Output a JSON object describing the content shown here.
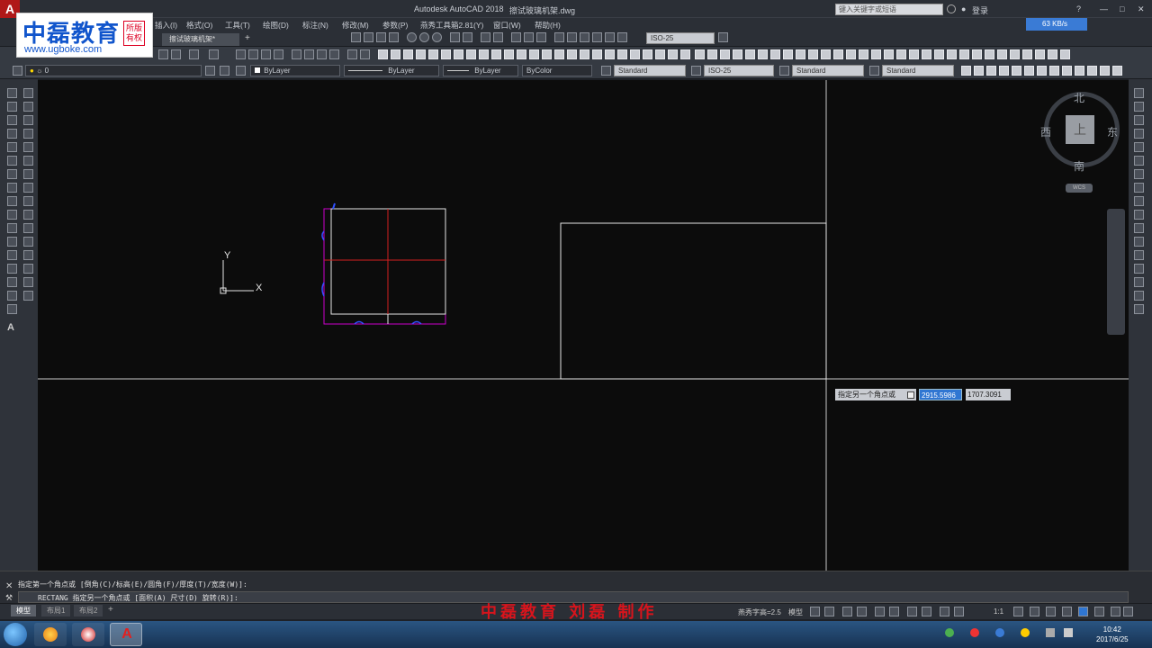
{
  "window": {
    "app_logo": "A",
    "title": "Autodesk AutoCAD 2018",
    "file_name": "擦试玻璃机架.dwg",
    "search_placeholder": "键入关键字或短语",
    "login_label": "登录",
    "help_label": "?"
  },
  "logo": {
    "brand_cn": "中磊教育",
    "url": "www.ugboke.com",
    "seal": "所版有权"
  },
  "speed_badge": "63 KB/s",
  "menu": [
    "插入(I)",
    "格式(O)",
    "工具(T)",
    "绘图(D)",
    "标注(N)",
    "修改(M)",
    "参数(P)",
    "燕秀工具箱2.81(Y)",
    "窗口(W)",
    "帮助(H)"
  ],
  "tabs": {
    "file_tab": "擦试玻璃机架*",
    "add_tab": "+",
    "dim_style": "ISO-25"
  },
  "properties": {
    "layer": "0",
    "color": "ByLayer",
    "linetype": "ByLayer",
    "lineweight": "ByLayer",
    "plotstyle": "ByColor",
    "text_style": "Standard",
    "dim_style": "ISO-25",
    "table_style": "Standard",
    "mleader_style": "Standard"
  },
  "viewcube": {
    "north": "北",
    "south": "南",
    "east": "东",
    "west": "西",
    "face": "上",
    "wcs": "WCS"
  },
  "ucs": {
    "x_label": "X",
    "y_label": "Y"
  },
  "dynamic_input": {
    "prompt": "指定另一个角点或",
    "x_value": "2915.5986",
    "y_value": "1707.3091"
  },
  "command": {
    "history": "指定第一个角点或 [倒角(C)/标高(E)/圆角(F)/厚度(T)/宽度(W)]:",
    "current": "RECTANG 指定另一个角点或 [面积(A) 尺寸(D) 旋转(R)]:"
  },
  "layout_tabs": [
    "模型",
    "布局1",
    "布局2"
  ],
  "layout_add": "+",
  "status": {
    "annotation": "燕秀字高=2.5",
    "model": "模型",
    "scale": "1:1"
  },
  "watermark": "中磊教育 刘磊 制作",
  "clock": {
    "time": "10:42",
    "date": "2017/6/25"
  },
  "colors": {
    "canvas": "#0c0c0c",
    "ui_dark": "#2b2f36",
    "accent_blue": "#2f76d2",
    "watermark_red": "#d8141c"
  }
}
